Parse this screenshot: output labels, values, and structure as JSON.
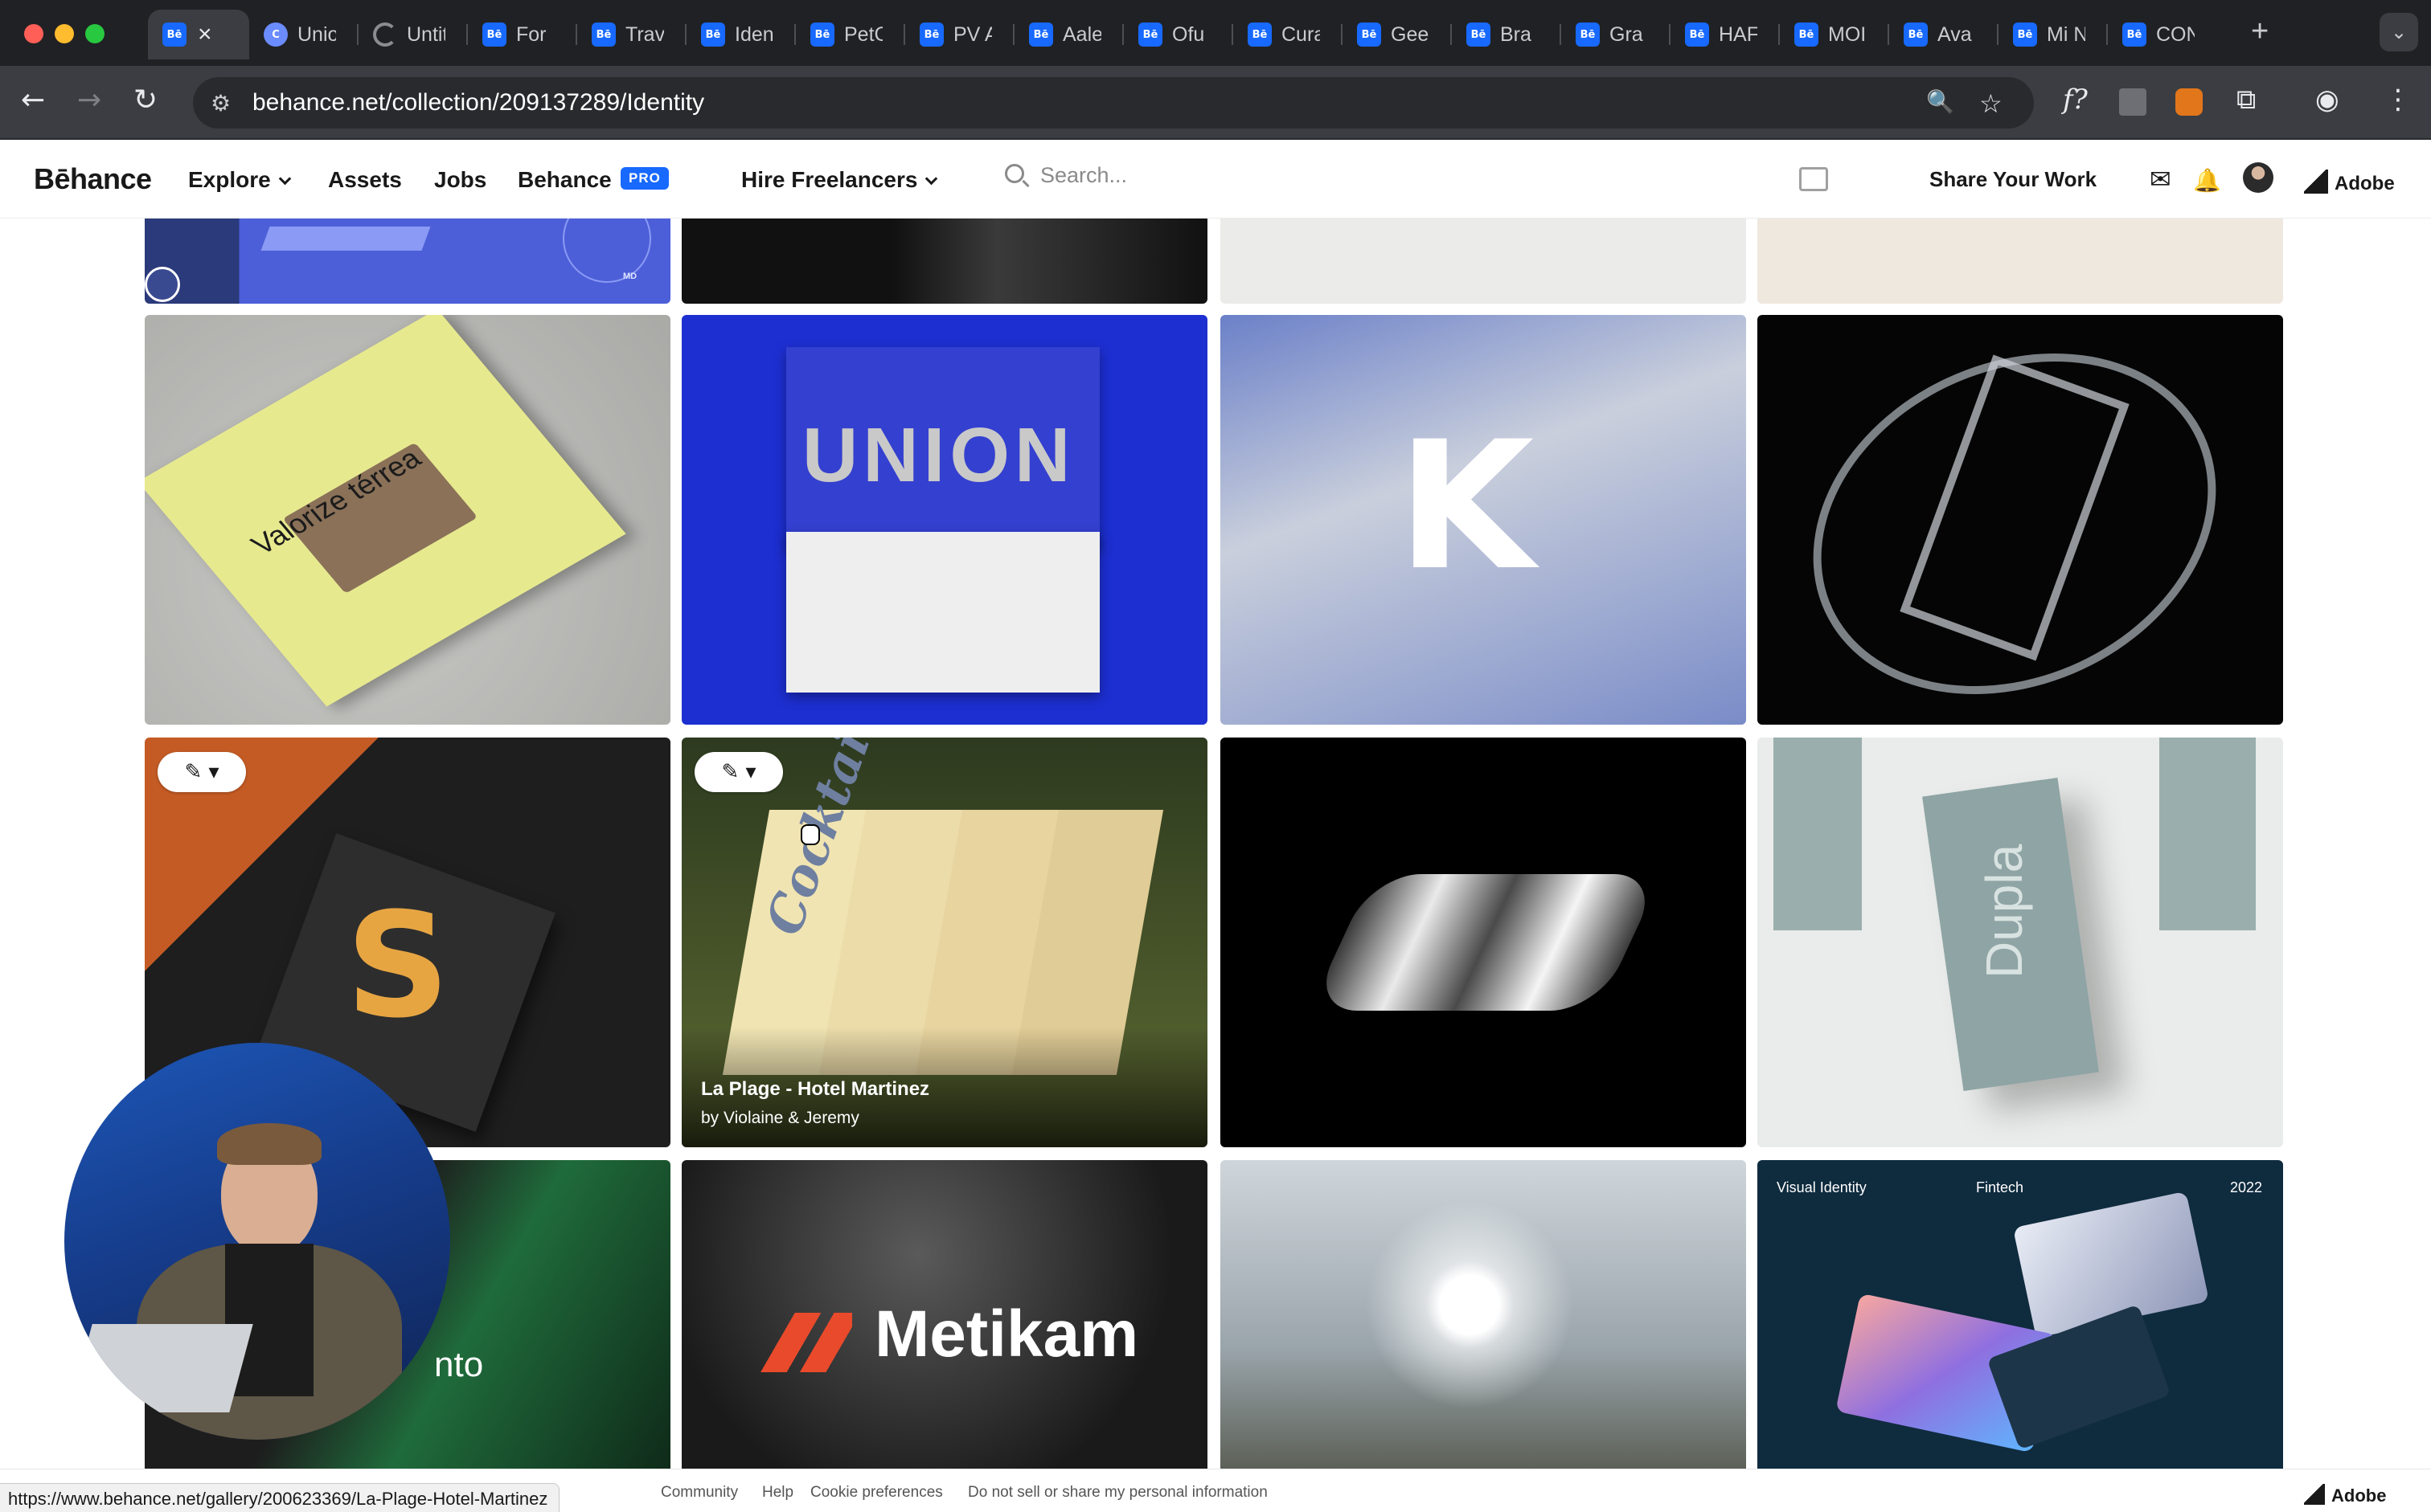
{
  "browser": {
    "active_tab_favicon": "Bē",
    "tabs": [
      {
        "title": "Unio",
        "favicon": "C"
      },
      {
        "title": "Untit",
        "favicon": "loading"
      },
      {
        "title": "For",
        "favicon": "Bē"
      },
      {
        "title": "Trav",
        "favicon": "Bē"
      },
      {
        "title": "Iden",
        "favicon": "Bē"
      },
      {
        "title": "PetC",
        "favicon": "Bē"
      },
      {
        "title": "PV A",
        "favicon": "Bē"
      },
      {
        "title": "Aale",
        "favicon": "Bē"
      },
      {
        "title": "Ofu",
        "favicon": "Bē"
      },
      {
        "title": "Cura",
        "favicon": "Bē"
      },
      {
        "title": "Gee",
        "favicon": "Bē"
      },
      {
        "title": "Bra",
        "favicon": "Bē"
      },
      {
        "title": "Gra",
        "favicon": "Bē"
      },
      {
        "title": "HAF",
        "favicon": "Bē"
      },
      {
        "title": "MOI",
        "favicon": "Bē"
      },
      {
        "title": "Ava",
        "favicon": "Bē"
      },
      {
        "title": "Mi N",
        "favicon": "Bē"
      },
      {
        "title": "CON",
        "favicon": "Bē"
      }
    ],
    "url": "behance.net/collection/209137289/Identity",
    "status_url": "https://www.behance.net/gallery/200623369/La-Plage-Hotel-Martinez",
    "icons": {
      "close": "×",
      "new_tab": "+",
      "tab_menu": "⌄",
      "back": "←",
      "forward": "→",
      "reload": "↻",
      "site_info": "⚙",
      "zoom": "🔍",
      "bookmark": "☆",
      "font_ext": "f?",
      "extensions": "⧉",
      "profile": "◉",
      "menu": "⋮"
    }
  },
  "behance": {
    "logo": "Bēhance",
    "nav": {
      "explore": "Explore",
      "assets": "Assets",
      "jobs": "Jobs",
      "behance_pro": "Behance",
      "pro_badge": "PRO",
      "hire": "Hire Freelancers"
    },
    "search_placeholder": "Search...",
    "share_work": "Share Your Work",
    "adobe": "Adobe",
    "icons": {
      "mail": "✉",
      "bell": "🔔"
    }
  },
  "gallery": {
    "edit_icon": "✎ ▾",
    "cards": [
      {
        "cover_text": "MD"
      },
      {
        "cover_text": ""
      },
      {
        "cover_text": ""
      },
      {
        "cover_text": ""
      },
      {
        "cover_text": "Valorize térrea"
      },
      {
        "cover_text": "UNION"
      },
      {
        "cover_text": "K"
      },
      {
        "cover_text": ""
      },
      {
        "cover_text": "S"
      },
      {
        "cover_text": "Cocktails",
        "title": "La Plage - Hotel Martinez",
        "owner": "by Violaine & Jeremy"
      },
      {
        "cover_text": ""
      },
      {
        "cover_text": "Dupla"
      },
      {
        "cover_text": "nto"
      },
      {
        "cover_text": "Metikam"
      },
      {
        "cover_text": ""
      },
      {
        "cover_text": "Visual Identity",
        "cover_text_2": "Fintech",
        "cover_text_3": "2022"
      }
    ]
  },
  "footer": {
    "links": [
      "Community",
      "Help",
      "Cookie preferences",
      "Do not sell or share my personal information"
    ],
    "adobe": "Adobe"
  },
  "colors": {
    "behance_blue": "#1769ff",
    "chrome_dark": "#202124",
    "chrome_toolbar": "#3b3d42"
  }
}
